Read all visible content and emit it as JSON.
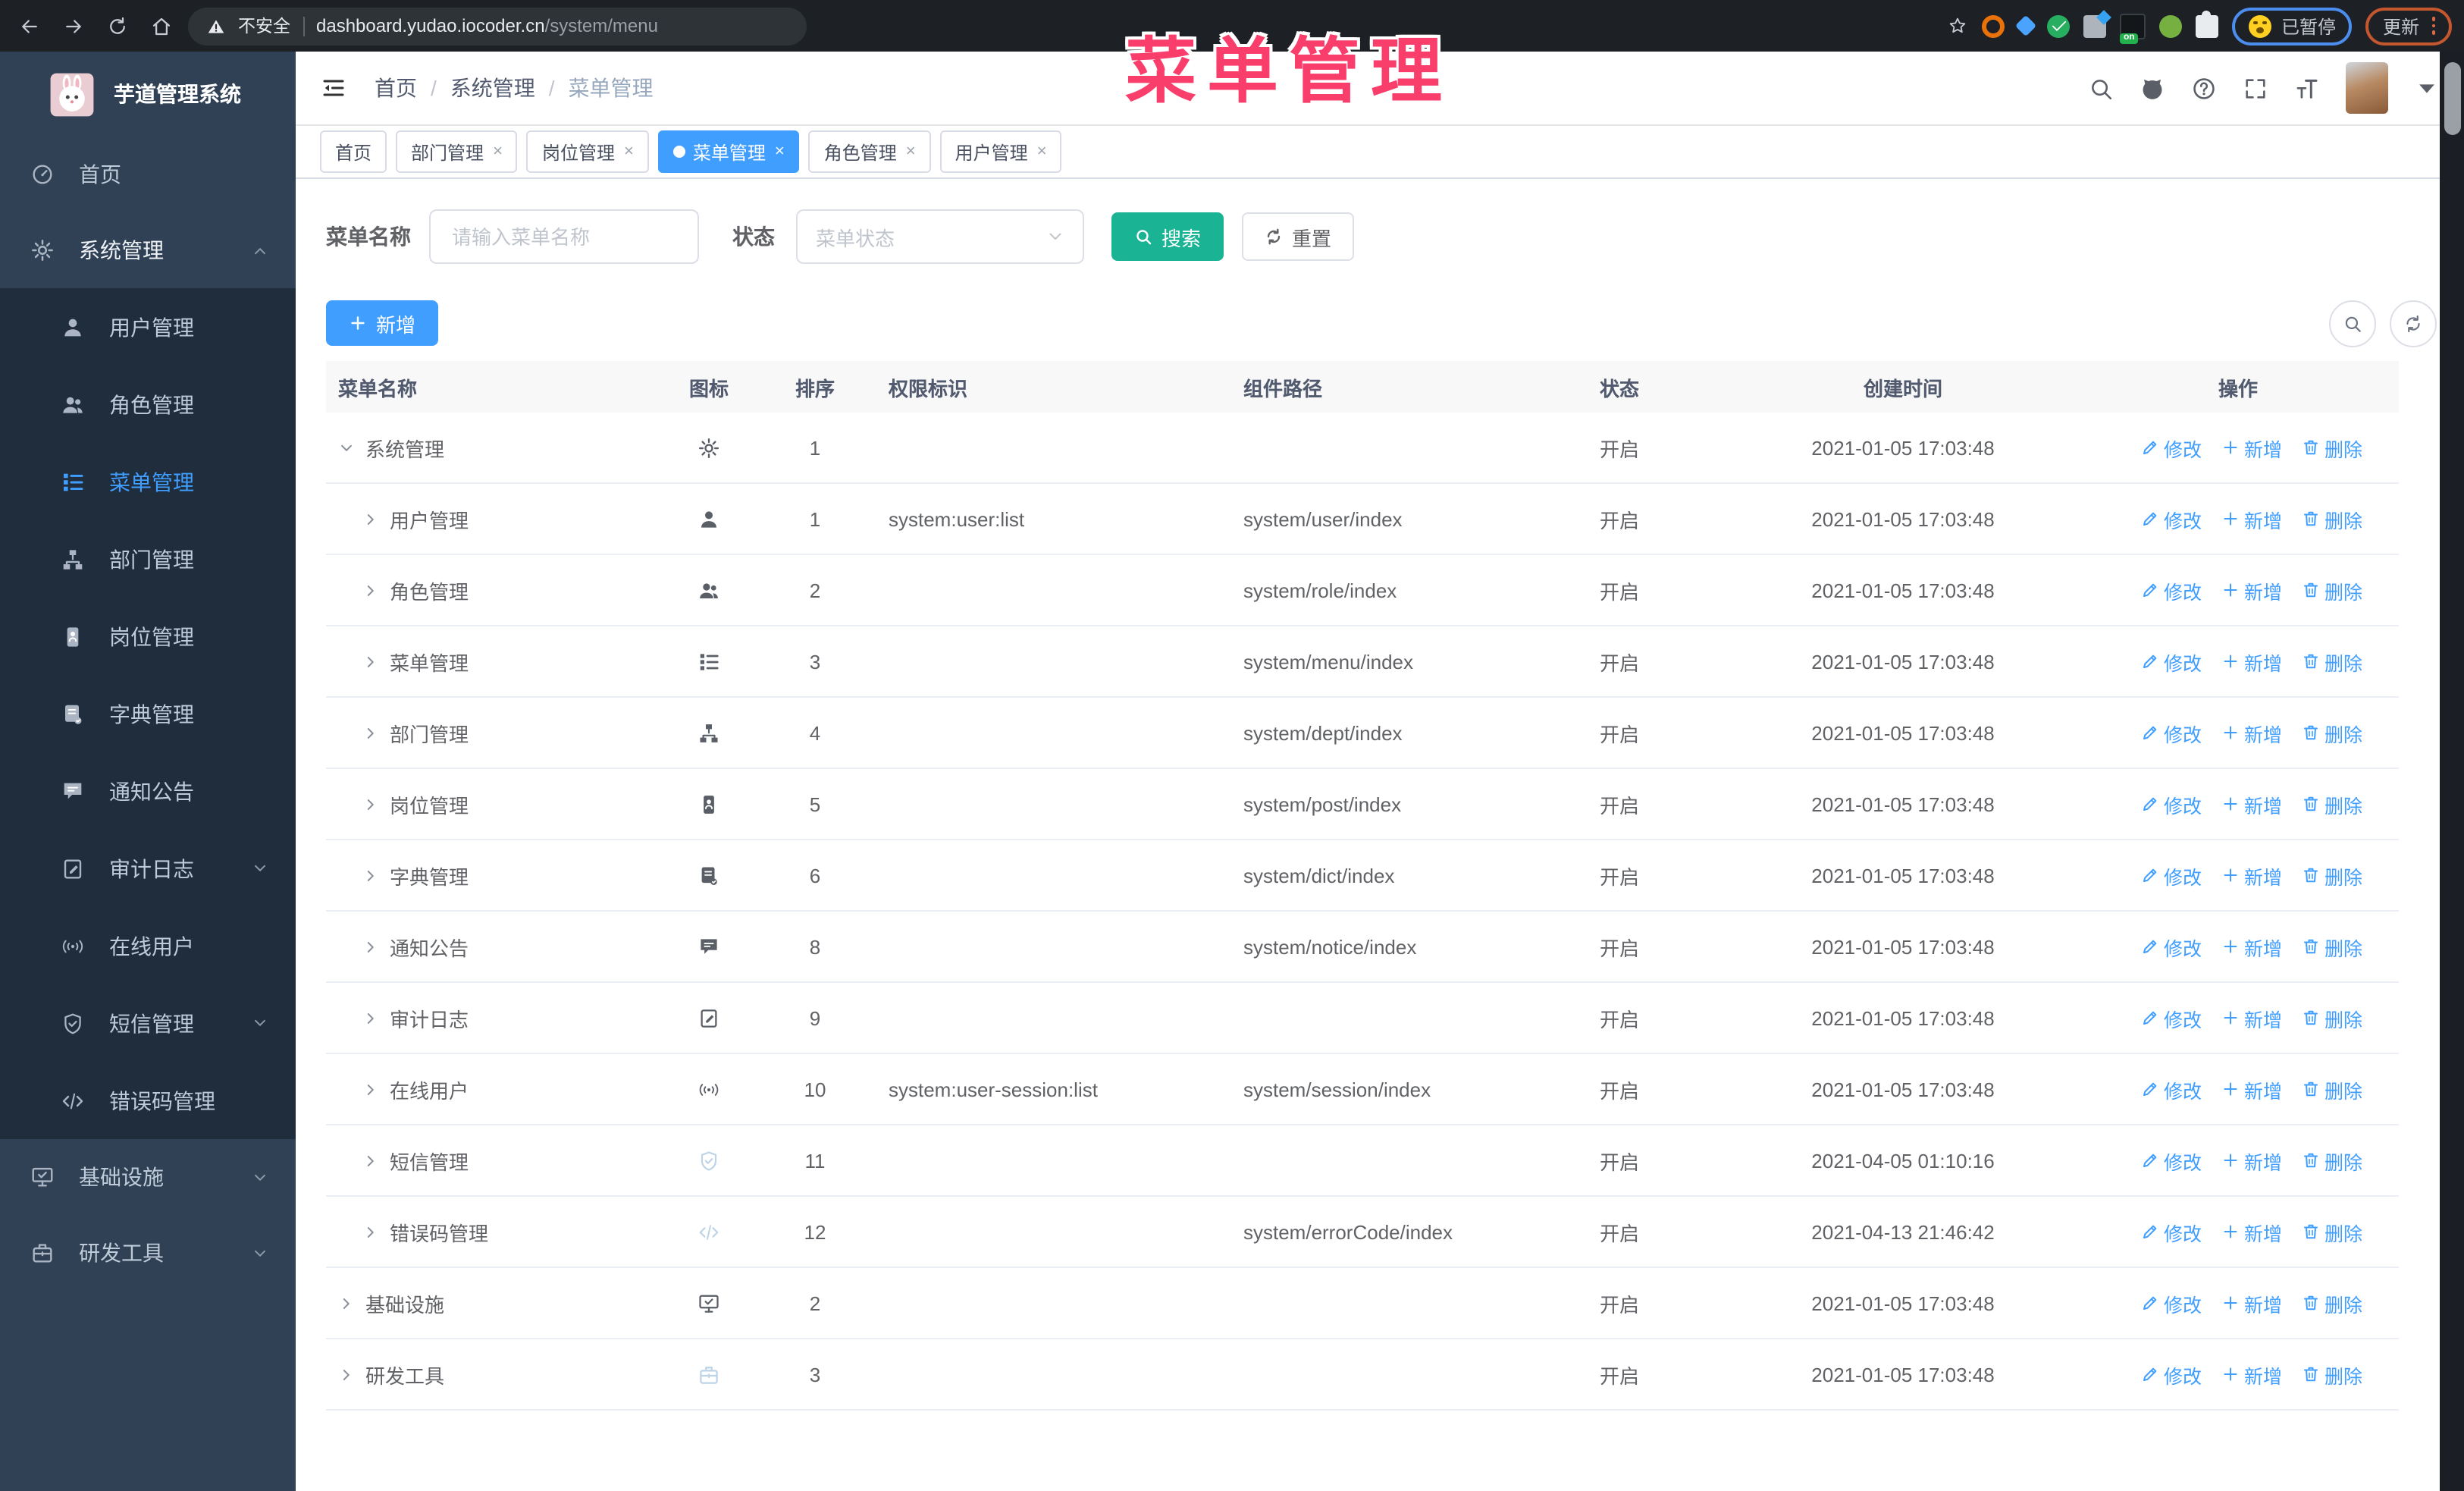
{
  "browser": {
    "security_label": "不安全",
    "url_host": "dashboard.yudao.iocoder.cn",
    "url_path": "/system/menu",
    "ext_on_badge": "on",
    "paused_label": "已暂停",
    "update_label": "更新"
  },
  "annotation": {
    "text": "菜单管理"
  },
  "sidebar": {
    "logo_title": "芋道管理系统",
    "items": [
      {
        "id": "home",
        "icon": "dashboard",
        "label": "首页"
      },
      {
        "id": "system",
        "icon": "gear",
        "label": "系统管理",
        "chevron": "up",
        "open": true
      },
      {
        "id": "user",
        "icon": "user",
        "label": "用户管理",
        "sub": true
      },
      {
        "id": "role",
        "icon": "people",
        "label": "角色管理",
        "sub": true
      },
      {
        "id": "menu",
        "icon": "treetable",
        "label": "菜单管理",
        "sub": true,
        "active": true
      },
      {
        "id": "dept",
        "icon": "tree",
        "label": "部门管理",
        "sub": true
      },
      {
        "id": "post",
        "icon": "post",
        "label": "岗位管理",
        "sub": true
      },
      {
        "id": "dict",
        "icon": "dict",
        "label": "字典管理",
        "sub": true
      },
      {
        "id": "notice",
        "icon": "message",
        "label": "通知公告",
        "sub": true
      },
      {
        "id": "auditlog",
        "icon": "log",
        "label": "审计日志",
        "sub": true,
        "chevron": "down"
      },
      {
        "id": "online",
        "icon": "online",
        "label": "在线用户",
        "sub": true
      },
      {
        "id": "sms",
        "icon": "shieldcheck",
        "label": "短信管理",
        "sub": true,
        "chevron": "down"
      },
      {
        "id": "errorcode",
        "icon": "code",
        "label": "错误码管理",
        "sub": true
      },
      {
        "id": "infra",
        "icon": "monitor",
        "label": "基础设施",
        "chevron": "down"
      },
      {
        "id": "devtool",
        "icon": "tool",
        "label": "研发工具",
        "chevron": "down"
      }
    ]
  },
  "header": {
    "breadcrumb": [
      "首页",
      "系统管理",
      "菜单管理"
    ]
  },
  "tags": [
    {
      "label": "首页",
      "closable": false,
      "active": false
    },
    {
      "label": "部门管理",
      "closable": true,
      "active": false
    },
    {
      "label": "岗位管理",
      "closable": true,
      "active": false
    },
    {
      "label": "菜单管理",
      "closable": true,
      "active": true
    },
    {
      "label": "角色管理",
      "closable": true,
      "active": false
    },
    {
      "label": "用户管理",
      "closable": true,
      "active": false
    }
  ],
  "filters": {
    "name_label": "菜单名称",
    "name_placeholder": "请输入菜单名称",
    "status_label": "状态",
    "status_placeholder": "菜单状态",
    "search_label": "搜索",
    "reset_label": "重置"
  },
  "toolbar": {
    "add_label": "新增"
  },
  "table": {
    "columns": {
      "name": "菜单名称",
      "icon": "图标",
      "sort": "排序",
      "perm": "权限标识",
      "path": "组件路径",
      "status": "状态",
      "created": "创建时间",
      "actions": "操作"
    },
    "action_labels": {
      "edit": "修改",
      "add": "新增",
      "delete": "删除"
    },
    "rows": [
      {
        "name": "系统管理",
        "indent": 0,
        "expand": "down",
        "icon": "gear",
        "muted": false,
        "sort": "1",
        "perm": "",
        "path": "",
        "status": "开启",
        "created": "2021-01-05 17:03:48"
      },
      {
        "name": "用户管理",
        "indent": 1,
        "expand": "right",
        "icon": "user",
        "muted": false,
        "sort": "1",
        "perm": "system:user:list",
        "path": "system/user/index",
        "status": "开启",
        "created": "2021-01-05 17:03:48"
      },
      {
        "name": "角色管理",
        "indent": 1,
        "expand": "right",
        "icon": "people",
        "muted": false,
        "sort": "2",
        "perm": "",
        "path": "system/role/index",
        "status": "开启",
        "created": "2021-01-05 17:03:48"
      },
      {
        "name": "菜单管理",
        "indent": 1,
        "expand": "right",
        "icon": "treetable",
        "muted": false,
        "sort": "3",
        "perm": "",
        "path": "system/menu/index",
        "status": "开启",
        "created": "2021-01-05 17:03:48"
      },
      {
        "name": "部门管理",
        "indent": 1,
        "expand": "right",
        "icon": "tree",
        "muted": false,
        "sort": "4",
        "perm": "",
        "path": "system/dept/index",
        "status": "开启",
        "created": "2021-01-05 17:03:48"
      },
      {
        "name": "岗位管理",
        "indent": 1,
        "expand": "right",
        "icon": "post",
        "muted": false,
        "sort": "5",
        "perm": "",
        "path": "system/post/index",
        "status": "开启",
        "created": "2021-01-05 17:03:48"
      },
      {
        "name": "字典管理",
        "indent": 1,
        "expand": "right",
        "icon": "dict",
        "muted": false,
        "sort": "6",
        "perm": "",
        "path": "system/dict/index",
        "status": "开启",
        "created": "2021-01-05 17:03:48"
      },
      {
        "name": "通知公告",
        "indent": 1,
        "expand": "right",
        "icon": "message",
        "muted": false,
        "sort": "8",
        "perm": "",
        "path": "system/notice/index",
        "status": "开启",
        "created": "2021-01-05 17:03:48"
      },
      {
        "name": "审计日志",
        "indent": 1,
        "expand": "right",
        "icon": "log",
        "muted": false,
        "sort": "9",
        "perm": "",
        "path": "",
        "status": "开启",
        "created": "2021-01-05 17:03:48"
      },
      {
        "name": "在线用户",
        "indent": 1,
        "expand": "right",
        "icon": "online",
        "muted": false,
        "sort": "10",
        "perm": "system:user-session:list",
        "path": "system/session/index",
        "status": "开启",
        "created": "2021-01-05 17:03:48"
      },
      {
        "name": "短信管理",
        "indent": 1,
        "expand": "right",
        "icon": "shieldcheck",
        "muted": true,
        "sort": "11",
        "perm": "",
        "path": "",
        "status": "开启",
        "created": "2021-04-05 01:10:16"
      },
      {
        "name": "错误码管理",
        "indent": 1,
        "expand": "right",
        "icon": "code",
        "muted": true,
        "sort": "12",
        "perm": "",
        "path": "system/errorCode/index",
        "status": "开启",
        "created": "2021-04-13 21:46:42"
      },
      {
        "name": "基础设施",
        "indent": 0,
        "expand": "right",
        "icon": "monitor",
        "muted": false,
        "sort": "2",
        "perm": "",
        "path": "",
        "status": "开启",
        "created": "2021-01-05 17:03:48"
      },
      {
        "name": "研发工具",
        "indent": 0,
        "expand": "right",
        "icon": "tool",
        "muted": true,
        "sort": "3",
        "perm": "",
        "path": "",
        "status": "开启",
        "created": "2021-01-05 17:03:48"
      }
    ]
  }
}
